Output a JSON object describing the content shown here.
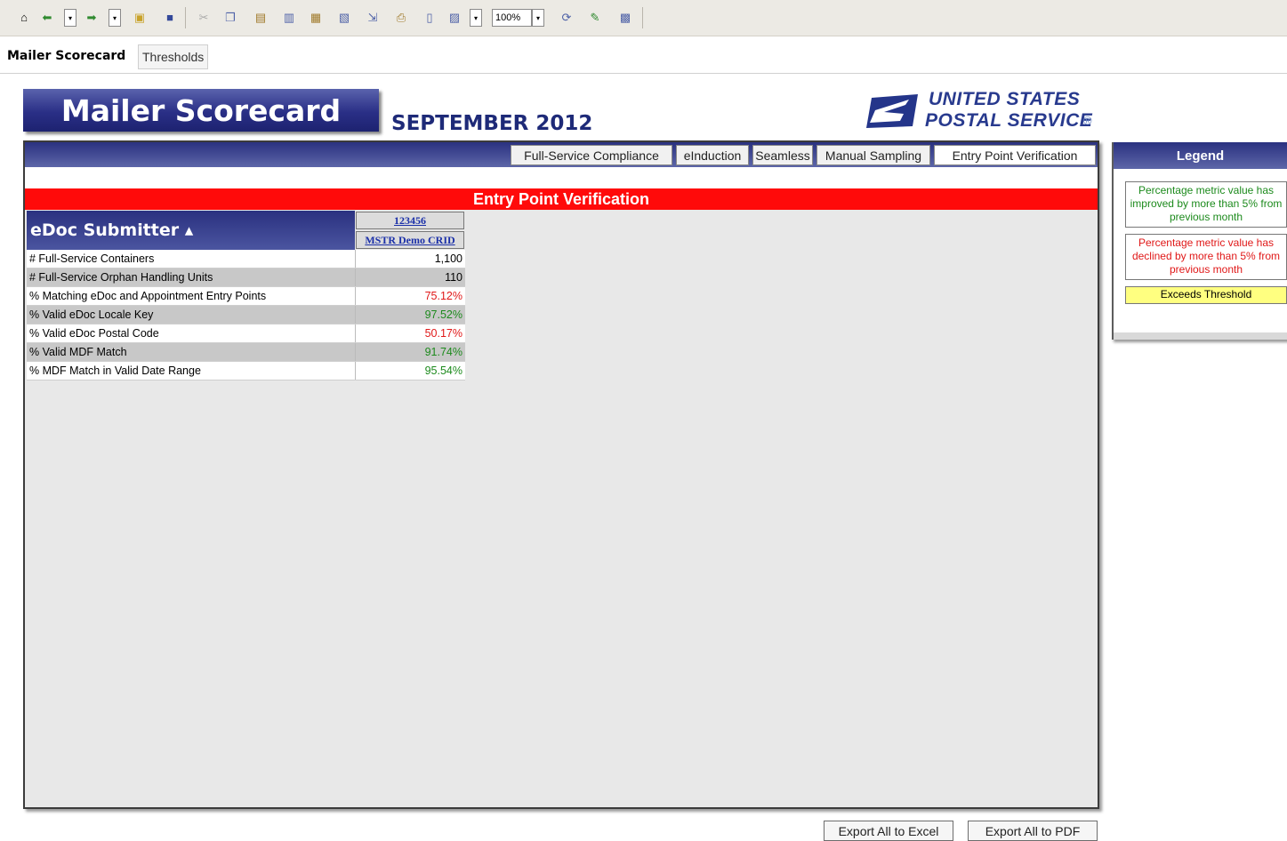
{
  "toolbar": {
    "icons": [
      "home-icon",
      "back-icon",
      "forward-icon",
      "open-folder-icon",
      "save-icon",
      "cut-icon",
      "copy-icon",
      "paste-icon",
      "print-preview-icon",
      "page-icon",
      "page-setup-icon",
      "export-icon",
      "print-icon",
      "document-icon",
      "view-icon",
      "refresh-icon",
      "edit-icon",
      "chart-icon"
    ],
    "zoom": "100%"
  },
  "tabs": {
    "scorecard": "Mailer Scorecard",
    "thresholds": "Thresholds"
  },
  "header": {
    "title": "Mailer Scorecard",
    "month": "SEPTEMBER 2012"
  },
  "logo": {
    "line1": "UNITED STATES",
    "line2": "POSTAL SERVICE",
    "reg": "®"
  },
  "nav": {
    "full_service": "Full-Service Compliance",
    "einduction": "eInduction",
    "seamless": "Seamless",
    "manual_sampling": "Manual Sampling",
    "entry_point": "Entry Point Verification"
  },
  "section_title": "Entry Point Verification",
  "grid": {
    "row_header": "eDoc Submitter ▴",
    "col_id": "123456",
    "col_name": "MSTR Demo CRID",
    "rows": [
      {
        "label": "# Full-Service Containers",
        "value": "1,100",
        "color": "#000000"
      },
      {
        "label": "# Full-Service Orphan Handling Units",
        "value": "110",
        "color": "#000000"
      },
      {
        "label": "% Matching eDoc and Appointment Entry Points",
        "value": "75.12%",
        "color": "#e01818"
      },
      {
        "label": "% Valid eDoc Locale Key",
        "value": "97.52%",
        "color": "#1c8a1c"
      },
      {
        "label": "% Valid eDoc Postal Code",
        "value": "50.17%",
        "color": "#e01818"
      },
      {
        "label": "% Valid MDF Match",
        "value": "91.74%",
        "color": "#1c8a1c"
      },
      {
        "label": "% MDF Match in Valid Date Range",
        "value": "95.54%",
        "color": "#1c8a1c"
      }
    ]
  },
  "legend": {
    "title": "Legend",
    "improved": "Percentage metric value has improved by more than 5% from previous month",
    "declined": "Percentage metric value has declined by more than 5% from previous month",
    "threshold": "Exceeds Threshold"
  },
  "export": {
    "excel": "Export All to Excel",
    "pdf": "Export All to PDF"
  }
}
